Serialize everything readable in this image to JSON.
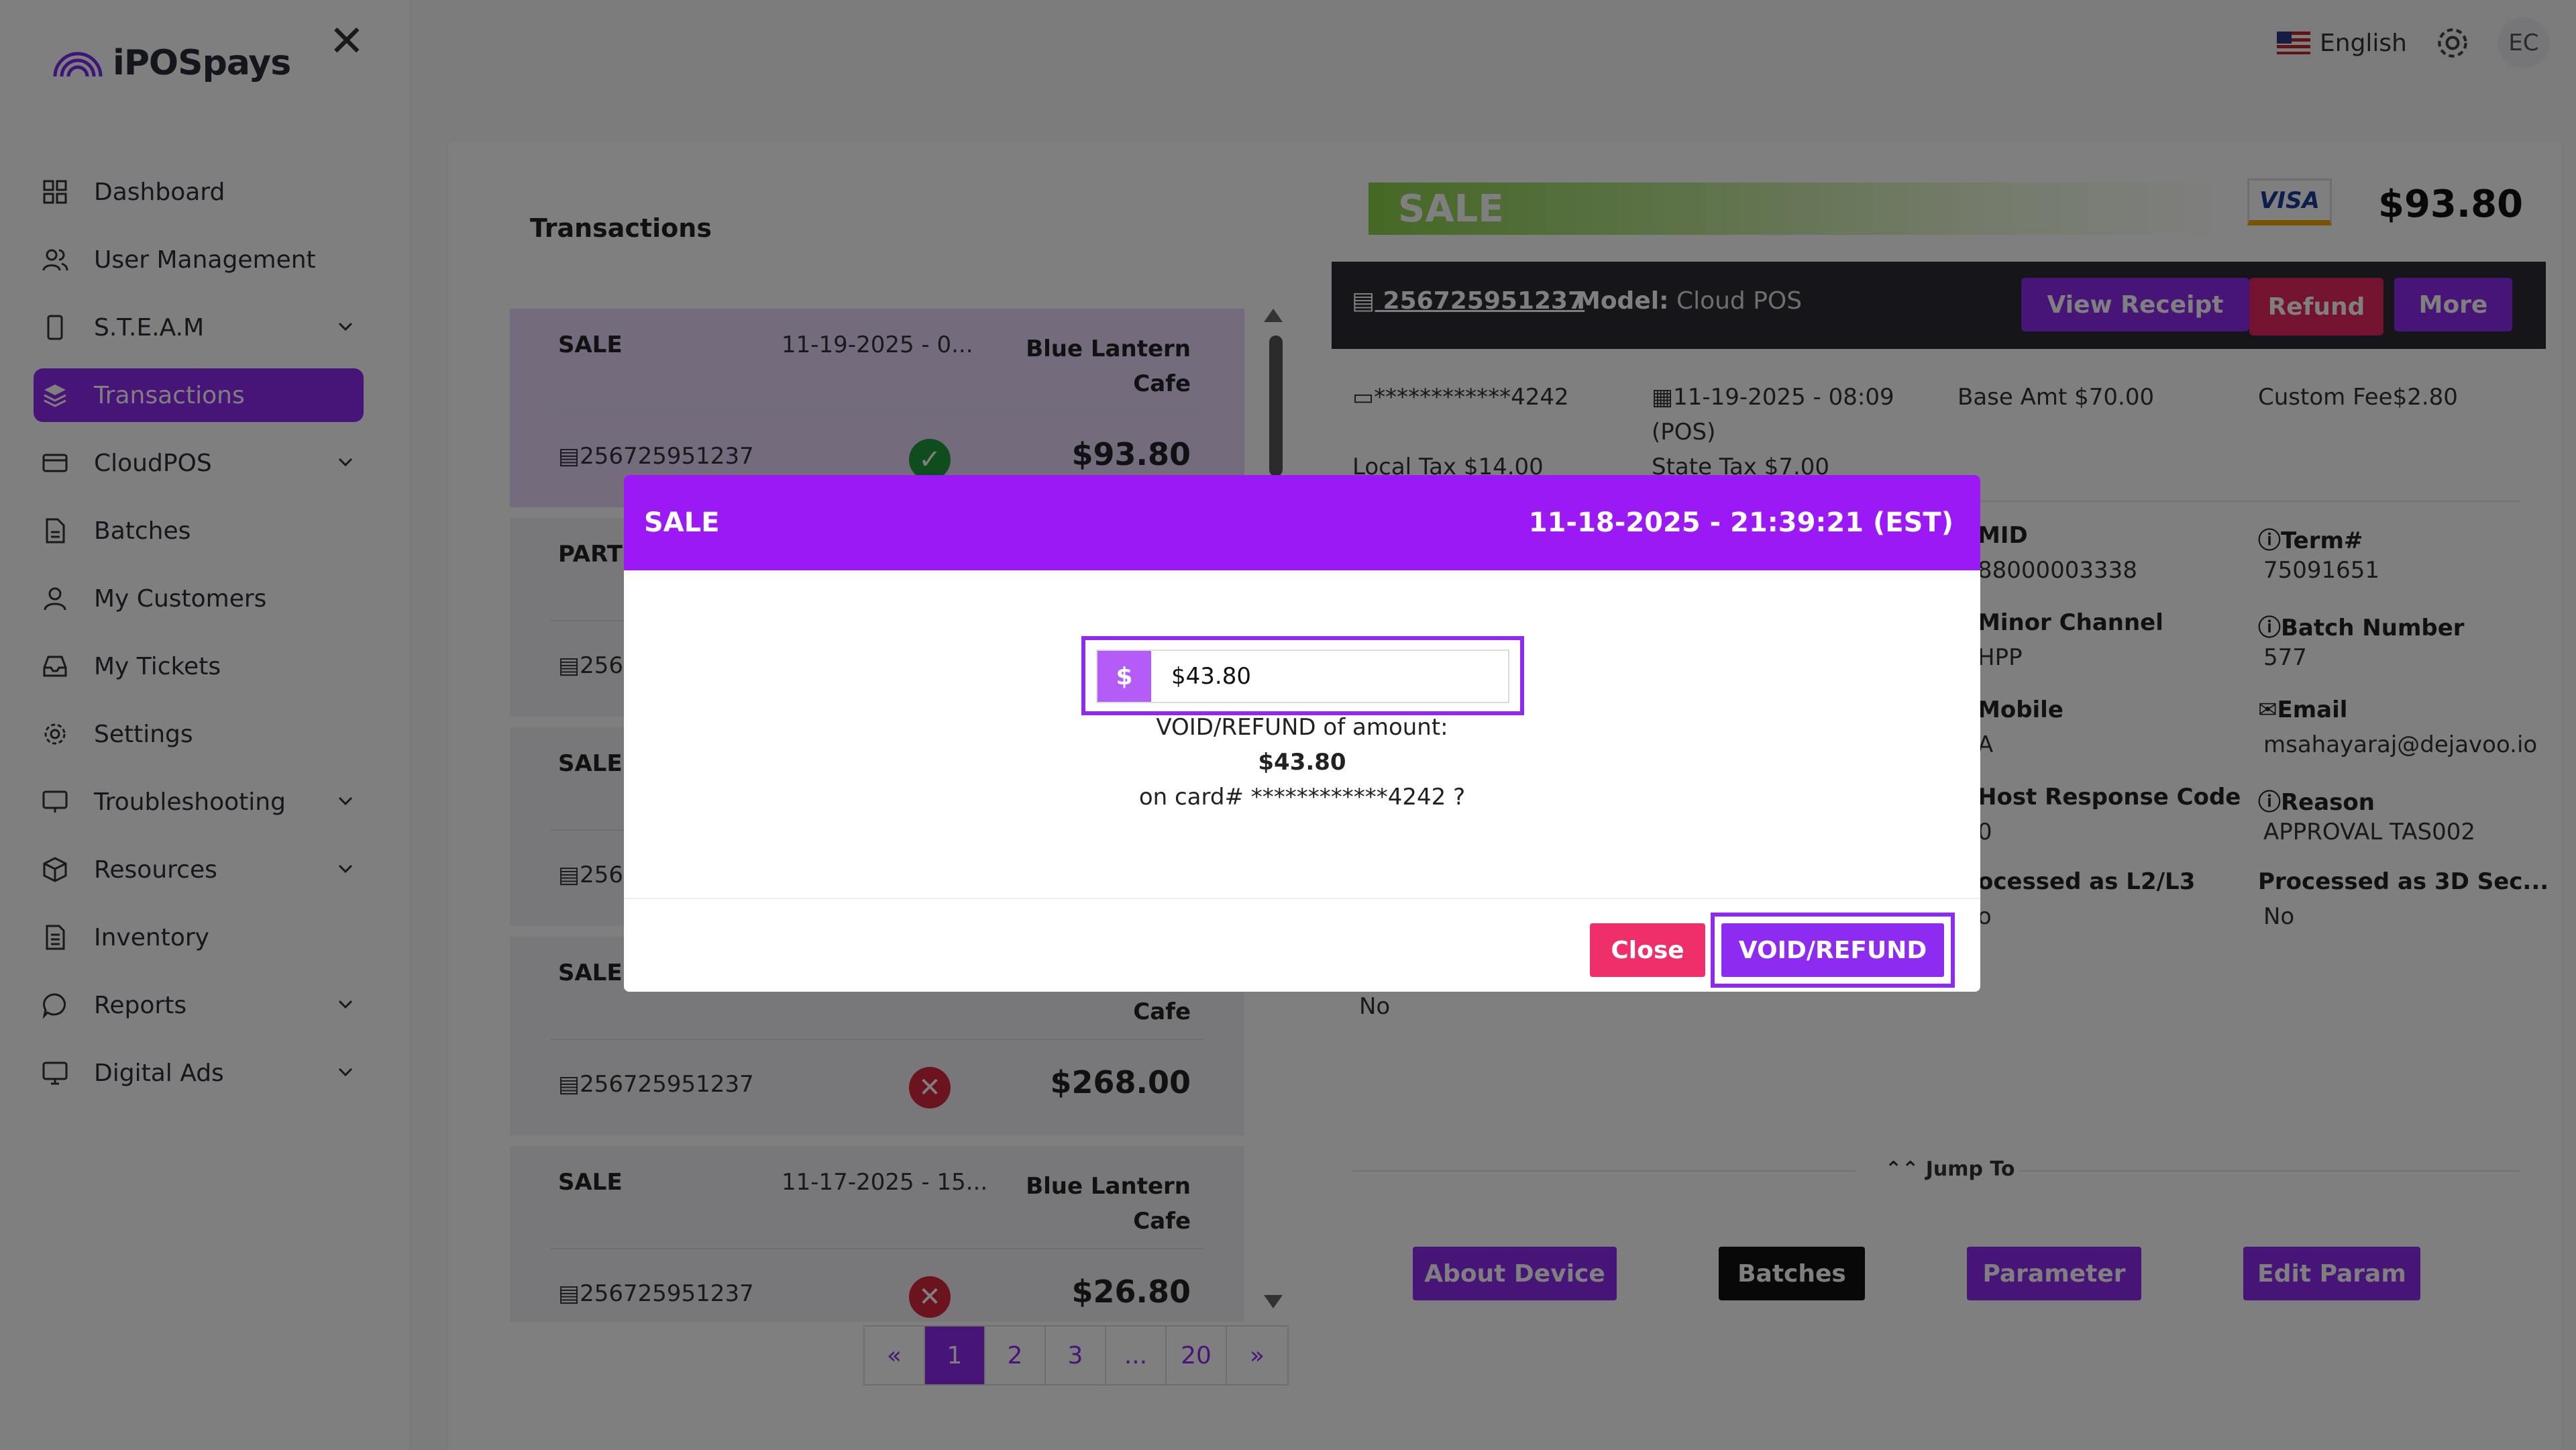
{
  "app": {
    "brand": "iPOSpays"
  },
  "topbar": {
    "language": "English",
    "avatar_initials": "EC"
  },
  "sidebar": {
    "items": [
      {
        "label": "Dashboard",
        "icon": "grid-icon",
        "has_chevron": false
      },
      {
        "label": "User Management",
        "icon": "users-icon",
        "has_chevron": false
      },
      {
        "label": "S.T.E.A.M",
        "icon": "device-icon",
        "has_chevron": true
      },
      {
        "label": "Transactions",
        "icon": "layers-icon",
        "has_chevron": false,
        "active": true
      },
      {
        "label": "CloudPOS",
        "icon": "card-icon",
        "has_chevron": true
      },
      {
        "label": "Batches",
        "icon": "document-icon",
        "has_chevron": false
      },
      {
        "label": "My Customers",
        "icon": "user-icon",
        "has_chevron": false
      },
      {
        "label": "My Tickets",
        "icon": "inbox-icon",
        "has_chevron": false
      },
      {
        "label": "Settings",
        "icon": "gear-icon",
        "has_chevron": false
      },
      {
        "label": "Troubleshooting",
        "icon": "monitor-icon",
        "has_chevron": true
      },
      {
        "label": "Resources",
        "icon": "box-icon",
        "has_chevron": true
      },
      {
        "label": "Inventory",
        "icon": "file-list-icon",
        "has_chevron": false
      },
      {
        "label": "Reports",
        "icon": "chat-icon",
        "has_chevron": true
      },
      {
        "label": "Digital Ads",
        "icon": "screen-icon",
        "has_chevron": true
      }
    ]
  },
  "transactions": {
    "title": "Transactions",
    "items": [
      {
        "type": "SALE",
        "date": "11-19-2025 - 0...",
        "merchant": "Blue Lantern Cafe",
        "tid": "256725951237",
        "status": "ok",
        "amount": "$93.80"
      },
      {
        "type": "PARTIAL",
        "date": "",
        "merchant": "",
        "tid": "256",
        "status": "",
        "amount": ""
      },
      {
        "type": "SALE",
        "date": "",
        "merchant": "",
        "tid": "256",
        "status": "",
        "amount": ""
      },
      {
        "type": "SALE",
        "date": "",
        "merchant": "Cafe",
        "tid": "256725951237",
        "status": "fail",
        "amount": "$268.00"
      },
      {
        "type": "SALE",
        "date": "11-17-2025 - 15...",
        "merchant": "Blue Lantern Cafe",
        "tid": "256725951237",
        "status": "fail",
        "amount": "$26.80"
      }
    ],
    "pagination": [
      "«",
      "1",
      "2",
      "3",
      "...",
      "20",
      "»"
    ]
  },
  "detail": {
    "banner": "SALE",
    "card_brand": "VISA",
    "total": "$93.80",
    "tid": "256725951237",
    "model_label": "Model:",
    "model_value": "Cloud POS",
    "buttons": {
      "view_receipt": "View Receipt",
      "refund": "Refund",
      "more": "More"
    },
    "card_masked": "************4242",
    "datetime": "11-19-2025 - 08:09",
    "datetime_source": "(POS)",
    "base_amt": "Base Amt $70.00",
    "custom_fee": "Custom Fee$2.80",
    "local_tax": "Local Tax $14.00",
    "state_tax": "State Tax $7.00",
    "fields": {
      "mid_label": "MID",
      "mid": "88000003338",
      "term_label": "Term#",
      "term": "75091651",
      "minor_channel_label": "Minor Channel",
      "minor_channel": "HPP",
      "batch_label": "Batch Number",
      "batch": "577",
      "mobile_label": "Mobile",
      "mobile": "A",
      "email_label": "Email",
      "email": "msahayaraj@dejavoo.io",
      "host_code_label": "Host Response Code",
      "host_code": "0",
      "reason_label": "Reason",
      "reason": "APPROVAL TAS002",
      "l2l3_label": "ocessed as L2/L3",
      "l2l3": "o",
      "threeds_label": "Processed as 3D Sec...",
      "threeds": "No",
      "extra": "No"
    },
    "jump_to": "Jump To",
    "bottom_buttons": {
      "about_device": "About Device",
      "batches": "Batches",
      "parameter": "Parameter",
      "edit_param": "Edit Param"
    }
  },
  "modal": {
    "title": "SALE",
    "datetime": "11-18-2025 - 21:39:21 (EST)",
    "currency_symbol": "$",
    "amount_value": "$43.80",
    "line1": "VOID/REFUND of amount:",
    "line2": "$43.80",
    "line3": "on card# ************4242 ?",
    "close_label": "Close",
    "confirm_label": "VOID/REFUND"
  },
  "colors": {
    "accent": "#8e2bf0",
    "danger": "#e8265e",
    "success": "#1f9a3b"
  }
}
